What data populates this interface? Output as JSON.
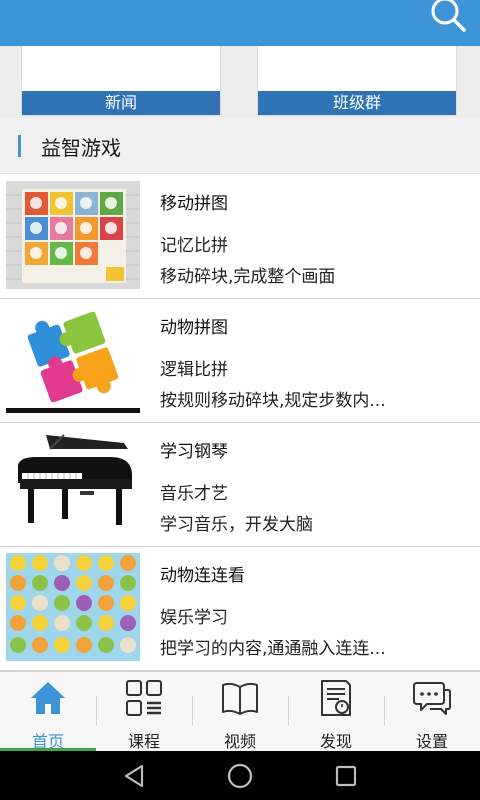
{
  "banners": [
    {
      "label": "新闻"
    },
    {
      "label": "班级群"
    }
  ],
  "section": {
    "title": "益智游戏"
  },
  "games": [
    {
      "title": "移动拼图",
      "tag": "记忆比拼",
      "desc": "移动碎块,完成整个画面"
    },
    {
      "title": "动物拼图",
      "tag": "逻辑比拼",
      "desc": "按规则移动碎块,规定步数内..."
    },
    {
      "title": "学习钢琴",
      "tag": "音乐才艺",
      "desc": "学习音乐，开发大脑"
    },
    {
      "title": "动物连连看",
      "tag": "娱乐学习",
      "desc": "把学习的内容,通通融入连连..."
    }
  ],
  "tabs": [
    {
      "label": "首页",
      "icon": "home-icon",
      "active": true
    },
    {
      "label": "课程",
      "icon": "grid-list-icon",
      "active": false
    },
    {
      "label": "视频",
      "icon": "book-icon",
      "active": false
    },
    {
      "label": "发现",
      "icon": "document-clock-icon",
      "active": false
    },
    {
      "label": "设置",
      "icon": "chat-bubbles-icon",
      "active": false
    }
  ],
  "colors": {
    "topbar": "#3d95d8",
    "banner_label": "#2f72b5",
    "tab_active": "#3d95d8",
    "tab_indicator": "#3ea64a"
  }
}
